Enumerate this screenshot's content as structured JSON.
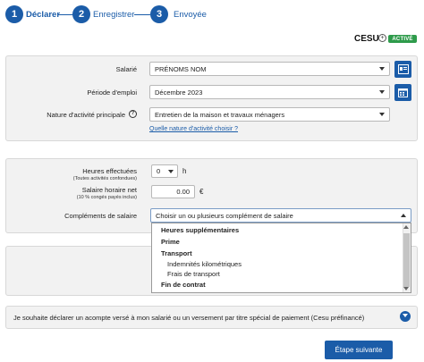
{
  "stepper": {
    "steps": [
      {
        "number": "1",
        "label": "Déclarer",
        "state": "active"
      },
      {
        "number": "2",
        "label": "Enregistrer",
        "state": "upcoming"
      },
      {
        "number": "3",
        "label": "Envoyée",
        "state": "upcoming"
      }
    ]
  },
  "cesu": {
    "logo_text": "CESU",
    "status_badge": "ACTIVÉ"
  },
  "employee_section": {
    "salarie_label": "Salarié",
    "salarie_value": "PRÉNOMS NOM",
    "periode_label": "Période d'emploi",
    "periode_value": "Décembre 2023",
    "nature_label": "Nature d'activité principale",
    "nature_value": "Entretien de la maison et travaux ménagers",
    "nature_help_link": "Quelle nature d'activité choisir ?"
  },
  "salary_section": {
    "heures_label": "Heures effectuées",
    "heures_sublabel": "(Toutes activités confondues)",
    "heures_value": "0",
    "heures_unit": "h",
    "taux_label": "Salaire horaire net",
    "taux_sublabel": "(10 % congés payés inclus)",
    "taux_value": "0.00",
    "taux_unit": "€",
    "complements_label": "Compléments de salaire",
    "complements_placeholder": "Choisir un ou plusieurs complément de salaire"
  },
  "complements_dropdown": {
    "items": [
      {
        "label": "Heures supplémentaires",
        "type": "group"
      },
      {
        "label": "Prime",
        "type": "group"
      },
      {
        "label": "Transport",
        "type": "group"
      },
      {
        "label": "Indemnités kilométriques",
        "type": "option"
      },
      {
        "label": "Frais de transport",
        "type": "option"
      },
      {
        "label": "Fin de contrat",
        "type": "group"
      }
    ]
  },
  "acompte": {
    "text": "Je souhaite déclarer un acompte versé à mon salarié ou un versement par titre spécial de paiement (Cesu préfinancé)"
  },
  "actions": {
    "next_label": "Étape suivante"
  },
  "colors": {
    "primary": "#1b5ca8",
    "success": "#2e9b4b",
    "panel_bg": "#f2f2f2"
  }
}
